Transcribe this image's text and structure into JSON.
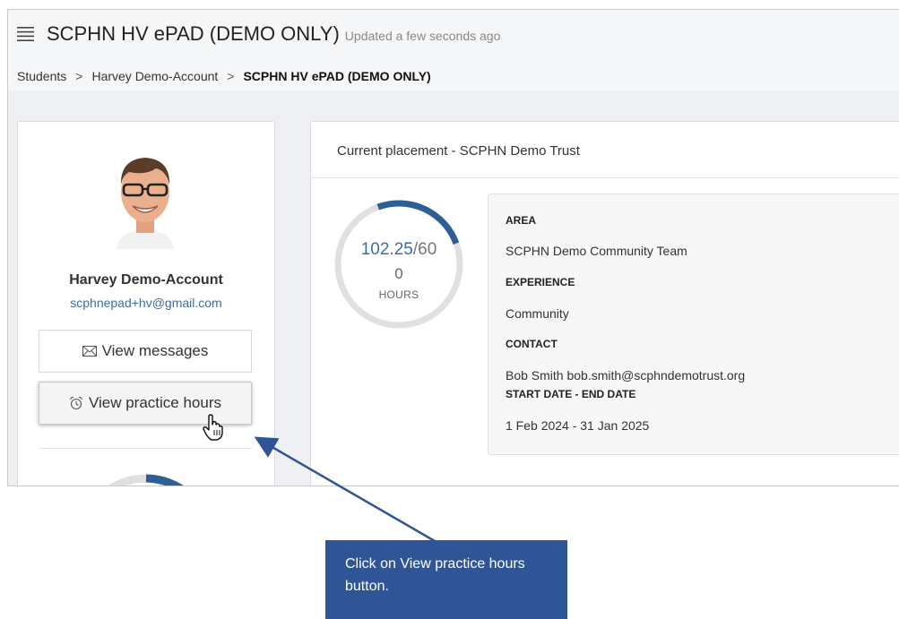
{
  "header": {
    "app_title": "SCPHN HV ePAD (DEMO ONLY)",
    "updated_text": "Updated a few seconds ago",
    "menu_icon": "hamburger-menu-icon"
  },
  "breadcrumb": {
    "items": [
      "Students",
      "Harvey Demo-Account",
      "SCPHN HV ePAD (DEMO ONLY)"
    ],
    "separator": ">"
  },
  "student": {
    "name": "Harvey Demo-Account",
    "email": "scphnepad+hv@gmail.com",
    "view_messages_label": "View messages",
    "view_practice_hours_label": "View practice hours",
    "messages_icon": "envelope-icon",
    "hours_icon": "alarm-clock-icon"
  },
  "placement": {
    "title": "Current placement - SCPHN Demo Trust",
    "hours_logged": "102.25",
    "hours_target": "/60",
    "hours_second": "0",
    "hours_unit": "HOURS",
    "area_label": "AREA",
    "area_value": "SCPHN Demo Community Team",
    "experience_label": "EXPERIENCE",
    "experience_value": "Community",
    "contact_label": "CONTACT",
    "contact_value": "Bob Smith bob.smith@scphndemotrust.org",
    "dates_label": "START DATE - END DATE",
    "dates_value": "1 Feb 2024 - 31 Jan 2025"
  },
  "callout": {
    "text": "Click on View practice hours button."
  },
  "colors": {
    "accent": "#2f5597",
    "link": "#3a6fa6",
    "ring_track": "#e0e0e0"
  }
}
